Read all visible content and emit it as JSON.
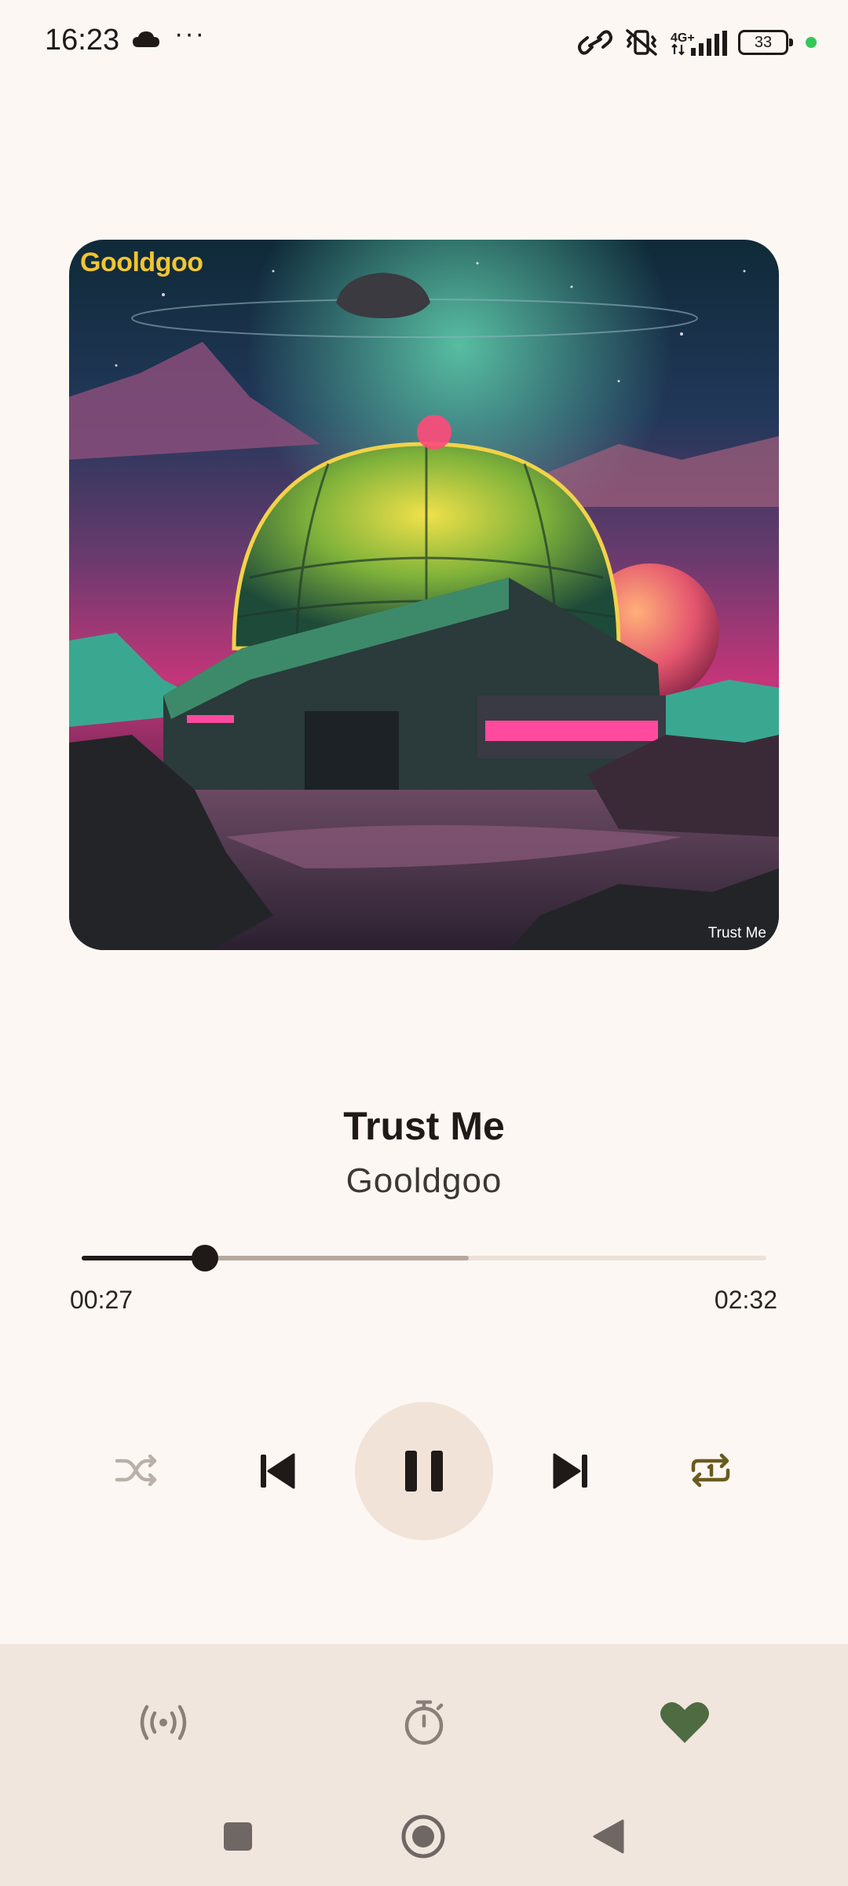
{
  "status_bar": {
    "time": "16:23",
    "overflow": "···",
    "network_label": "4G+",
    "battery": "33"
  },
  "album": {
    "brand_text": "Gooldgoo",
    "caption_text": "Trust Me"
  },
  "track": {
    "title": "Trust Me",
    "artist": "Gooldgoo"
  },
  "progress": {
    "elapsed": "00:27",
    "total": "02:32",
    "played_fraction": 0.18,
    "buffered_fraction": 0.565
  },
  "controls": {
    "shuffle_icon": "shuffle-icon",
    "previous_icon": "skip-previous-icon",
    "play_state_icon": "pause-icon",
    "next_icon": "skip-next-icon",
    "repeat_icon": "repeat-one-icon"
  },
  "bottom_bar": {
    "cast_icon": "broadcast-icon",
    "timer_icon": "sleep-timer-icon",
    "favorite_icon": "heart-icon",
    "favorite_color": "#4e6b42"
  },
  "colors": {
    "background": "#fcf7f3",
    "bottom_bar": "#f1e6dd",
    "play_button_bg": "#f1e3d7",
    "accent_repeat": "#6b5a1e"
  }
}
